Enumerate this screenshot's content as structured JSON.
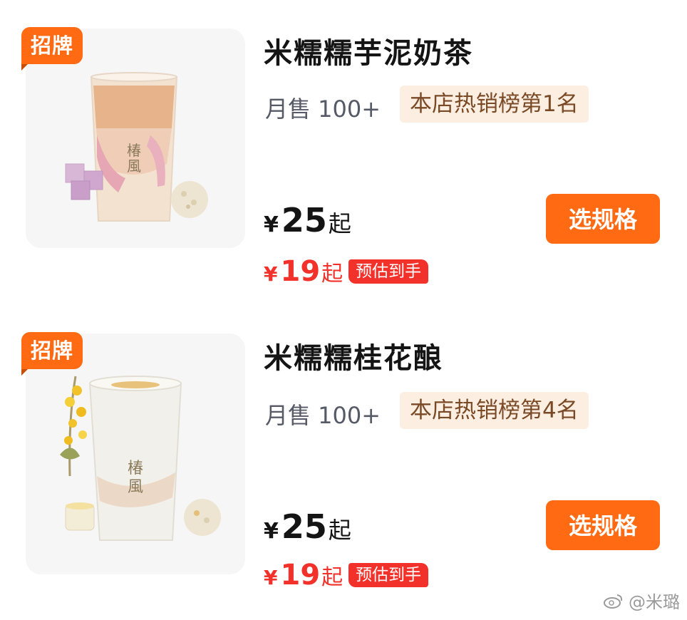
{
  "products": [
    {
      "badge": "招牌",
      "title": "米糯糯芋泥奶茶",
      "sales": "月售 100+",
      "rank": "本店热销榜第1名",
      "price_currency": "¥",
      "price": "25",
      "price_suffix": "起",
      "est_currency": "¥",
      "est_price": "19",
      "est_suffix": "起",
      "est_tag": "预估到手",
      "button": "选规格",
      "image_icon": "taro-milk-tea-cup",
      "cup_logo": "椿風"
    },
    {
      "badge": "招牌",
      "title": "米糯糯桂花酿",
      "sales": "月售 100+",
      "rank": "本店热销榜第4名",
      "price_currency": "¥",
      "price": "25",
      "price_suffix": "起",
      "est_currency": "¥",
      "est_price": "19",
      "est_suffix": "起",
      "est_tag": "预估到手",
      "button": "选规格",
      "image_icon": "osmanthus-drink-cup",
      "cup_logo": "椿風"
    }
  ],
  "watermark": "@米璐",
  "colors": {
    "accent": "#ff6a13",
    "price_red": "#f2322a",
    "rank_bg": "#fdeee2",
    "rank_text": "#7a4a26"
  }
}
